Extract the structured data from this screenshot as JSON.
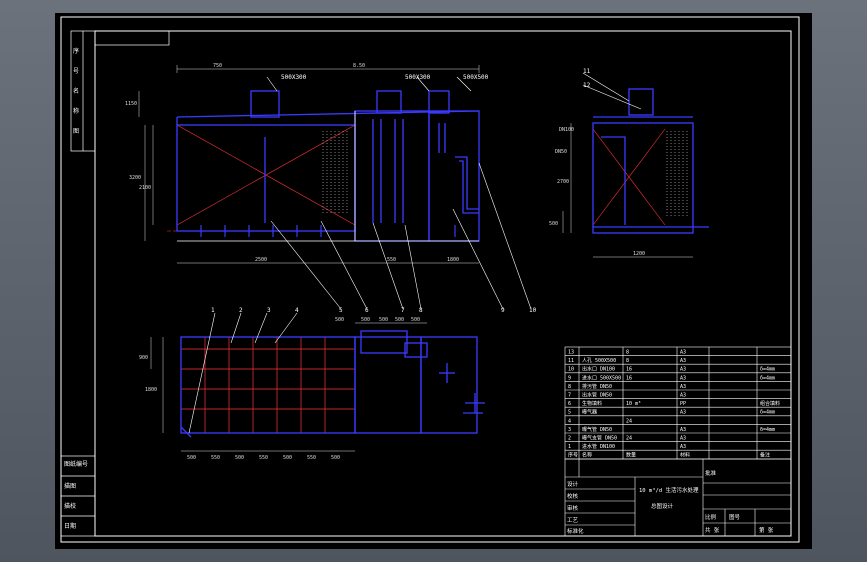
{
  "canvas": {
    "background_color": "#000000",
    "viewport_color": "#5a616b",
    "outline_color": "#ffffff",
    "equipment_color": "#3a3aff",
    "hatch_color": "#ff3333",
    "leader_color": "#ffffff",
    "dimension_color": "#dddddd"
  },
  "callouts": {
    "front": [
      "1",
      "2",
      "3",
      "4",
      "5",
      "6",
      "7",
      "8",
      "9",
      "10"
    ],
    "side": [
      "11",
      "12"
    ],
    "pipe_labels": [
      "500X300",
      "500X300",
      "500X500"
    ]
  },
  "dimensions": {
    "front_top": [
      "750",
      "8.50"
    ],
    "front_bottom": [
      "2500",
      "550",
      "1800"
    ],
    "front_left": [
      "3200",
      "2100",
      "1150"
    ],
    "plan_bottom": [
      "500",
      "550",
      "500",
      "550",
      "500",
      "550",
      "500",
      "550",
      "500",
      "550"
    ],
    "plan_top": [
      "500",
      "500",
      "500",
      "500",
      "500"
    ],
    "plan_left": [
      "900",
      "1800"
    ],
    "side_bottom": [
      "1200"
    ],
    "side_left": [
      "2700",
      "500"
    ],
    "side_labels": [
      "DN100",
      "DN50"
    ]
  },
  "parts_table": {
    "rows": [
      {
        "no": "13",
        "name": "",
        "qty": "8",
        "material": "A3",
        "note": ""
      },
      {
        "no": "11",
        "name": "人孔 500X500",
        "qty": "8",
        "material": "A3",
        "note": ""
      },
      {
        "no": "10",
        "name": "出水口 DN100",
        "qty": "16",
        "material": "A3",
        "note": "δ=4mm"
      },
      {
        "no": "9",
        "name": "进水口 500X500",
        "qty": "16",
        "material": "A3",
        "note": "δ=4mm"
      },
      {
        "no": "8",
        "name": "排污管 DN50",
        "qty": "",
        "material": "A3",
        "note": ""
      },
      {
        "no": "7",
        "name": "出水管 DN50",
        "qty": "",
        "material": "A3",
        "note": ""
      },
      {
        "no": "6",
        "name": "生物填料",
        "qty": "10 m³",
        "material": "PP",
        "note": "组合填料"
      },
      {
        "no": "5",
        "name": "曝气器",
        "qty": "",
        "material": "A3",
        "note": "δ=4mm"
      },
      {
        "no": "4",
        "name": "",
        "qty": "24",
        "material": "",
        "note": ""
      },
      {
        "no": "3",
        "name": "曝气管 DN50",
        "qty": "",
        "material": "A3",
        "note": "δ=4mm"
      },
      {
        "no": "2",
        "name": "曝气支管 DN50",
        "qty": "24",
        "material": "A3",
        "note": ""
      },
      {
        "no": "1",
        "name": "进水管 DN100",
        "qty": "",
        "material": "A3",
        "note": ""
      }
    ],
    "header": [
      "序号",
      "名称",
      "数量",
      "材料",
      "备注"
    ]
  },
  "title_block": {
    "title_line1": "10 m³/d 生活污水处理",
    "title_line2": "总图设计",
    "fields": [
      "设计",
      "校核",
      "审核",
      "工艺",
      "标准化",
      "批准"
    ],
    "right_fields": [
      "比例",
      "图号",
      "共 张",
      "第 张"
    ]
  },
  "side_strip": [
    "图纸编号",
    "描图",
    "描校",
    "日期"
  ]
}
